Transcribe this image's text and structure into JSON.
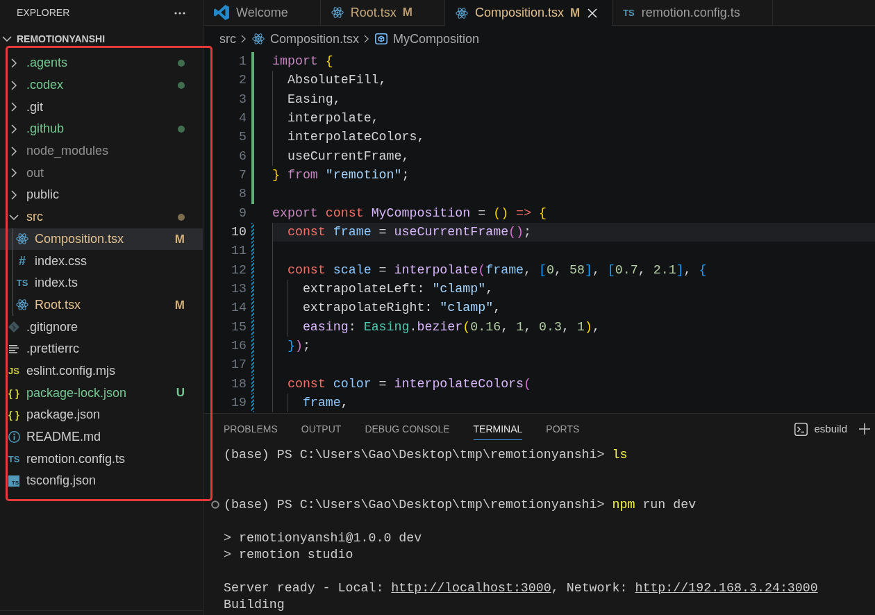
{
  "explorer": {
    "title": "EXPLORER",
    "root": {
      "label": "REMOTIONYANSHI",
      "expanded": true
    },
    "tree": [
      {
        "name": ".agents",
        "kind": "folder",
        "modified": false,
        "untracked": true,
        "ignored": false,
        "expanded": false,
        "selected": false
      },
      {
        "name": ".codex",
        "kind": "folder",
        "modified": false,
        "untracked": true,
        "ignored": false,
        "expanded": false,
        "selected": false
      },
      {
        "name": ".git",
        "kind": "folder",
        "modified": false,
        "untracked": false,
        "ignored": false,
        "expanded": false,
        "selected": false
      },
      {
        "name": ".github",
        "kind": "folder",
        "modified": false,
        "untracked": true,
        "ignored": false,
        "expanded": false,
        "selected": false
      },
      {
        "name": "node_modules",
        "kind": "folder",
        "modified": false,
        "untracked": false,
        "ignored": true,
        "expanded": false,
        "selected": false
      },
      {
        "name": "out",
        "kind": "folder",
        "modified": false,
        "untracked": false,
        "ignored": true,
        "expanded": false,
        "selected": false
      },
      {
        "name": "public",
        "kind": "folder",
        "modified": false,
        "untracked": false,
        "ignored": false,
        "expanded": false,
        "selected": false
      },
      {
        "name": "src",
        "kind": "folder",
        "modified": true,
        "untracked": false,
        "ignored": false,
        "expanded": true,
        "selected": false,
        "children": [
          {
            "name": "Composition.tsx",
            "kind": "react",
            "modified": true,
            "untracked": false,
            "ignored": false,
            "badge": "M",
            "selected": true
          },
          {
            "name": "index.css",
            "kind": "css",
            "icon_text": "#",
            "modified": false,
            "untracked": false,
            "ignored": false,
            "selected": false
          },
          {
            "name": "index.ts",
            "kind": "ts",
            "icon_text": "TS",
            "modified": false,
            "untracked": false,
            "ignored": false,
            "selected": false
          },
          {
            "name": "Root.tsx",
            "kind": "react",
            "modified": true,
            "untracked": false,
            "ignored": false,
            "badge": "M",
            "selected": false
          }
        ]
      },
      {
        "name": ".gitignore",
        "kind": "git",
        "modified": false,
        "untracked": false,
        "ignored": false,
        "selected": false
      },
      {
        "name": ".prettierrc",
        "kind": "lines",
        "modified": false,
        "untracked": false,
        "ignored": false,
        "selected": false
      },
      {
        "name": "eslint.config.mjs",
        "kind": "js",
        "icon_text": "JS",
        "modified": false,
        "untracked": false,
        "ignored": false,
        "selected": false
      },
      {
        "name": "package-lock.json",
        "kind": "json",
        "icon_text": "{ }",
        "modified": false,
        "untracked": true,
        "ignored": false,
        "badge": "U",
        "selected": false
      },
      {
        "name": "package.json",
        "kind": "json",
        "icon_text": "{ }",
        "modified": false,
        "untracked": false,
        "ignored": false,
        "selected": false
      },
      {
        "name": "README.md",
        "kind": "info",
        "modified": false,
        "untracked": false,
        "ignored": false,
        "selected": false
      },
      {
        "name": "remotion.config.ts",
        "kind": "ts",
        "icon_text": "TS",
        "modified": false,
        "untracked": false,
        "ignored": false,
        "selected": false
      },
      {
        "name": "tsconfig.json",
        "kind": "tsconfig",
        "icon_text": "TS",
        "modified": false,
        "untracked": false,
        "ignored": false,
        "selected": false
      }
    ]
  },
  "tabs": [
    {
      "label": "Welcome",
      "kind": "vscode",
      "modified": false,
      "selected": false
    },
    {
      "label": "Root.tsx",
      "kind": "react",
      "modified": true,
      "badge": "M",
      "selected": false
    },
    {
      "label": "Composition.tsx",
      "kind": "react",
      "modified": true,
      "badge": "M",
      "selected": true
    },
    {
      "label": "remotion.config.ts",
      "kind": "ts",
      "icon_text": "TS",
      "modified": false,
      "selected": false
    }
  ],
  "breadcrumbs": [
    {
      "label": "src",
      "kind": "folder"
    },
    {
      "label": "Composition.tsx",
      "kind": "react"
    },
    {
      "label": "MyComposition",
      "kind": "symbol"
    }
  ],
  "editor": {
    "lines": [
      {
        "number": "1",
        "added": true,
        "modified": false,
        "current": false,
        "tokens": [
          {
            "text": "import ",
            "kind": "keyword"
          },
          {
            "text": "{",
            "kind": "bracket1"
          }
        ]
      },
      {
        "number": "2",
        "added": true,
        "modified": false,
        "current": false,
        "tokens": [
          {
            "text": "  AbsoluteFill,",
            "kind": "plain"
          }
        ]
      },
      {
        "number": "3",
        "added": true,
        "modified": false,
        "current": false,
        "tokens": [
          {
            "text": "  Easing,",
            "kind": "plain"
          }
        ]
      },
      {
        "number": "4",
        "added": true,
        "modified": false,
        "current": false,
        "tokens": [
          {
            "text": "  interpolate,",
            "kind": "plain"
          }
        ]
      },
      {
        "number": "5",
        "added": true,
        "modified": false,
        "current": false,
        "tokens": [
          {
            "text": "  interpolateColors,",
            "kind": "plain"
          }
        ]
      },
      {
        "number": "6",
        "added": true,
        "modified": false,
        "current": false,
        "tokens": [
          {
            "text": "  useCurrentFrame,",
            "kind": "plain"
          }
        ]
      },
      {
        "number": "7",
        "added": true,
        "modified": false,
        "current": false,
        "tokens": [
          {
            "text": "}",
            "kind": "bracket1"
          },
          {
            "text": " from ",
            "kind": "keyword"
          },
          {
            "text": "\"remotion\"",
            "kind": "string"
          },
          {
            "text": ";",
            "kind": "plain"
          }
        ]
      },
      {
        "number": "8",
        "added": true,
        "modified": false,
        "current": false
      },
      {
        "number": "9",
        "added": false,
        "modified": false,
        "current": false,
        "tokens": [
          {
            "text": "export ",
            "kind": "keyword"
          },
          {
            "text": "const ",
            "kind": "storage"
          },
          {
            "text": "MyComposition",
            "kind": "function"
          },
          {
            "text": " = ",
            "kind": "plain"
          },
          {
            "text": "()",
            "kind": "bracket1"
          },
          {
            "text": " => ",
            "kind": "storage"
          },
          {
            "text": "{",
            "kind": "bracket1"
          }
        ]
      },
      {
        "number": "10",
        "added": false,
        "modified": true,
        "current": true,
        "tokens": [
          {
            "text": "  const ",
            "kind": "storage"
          },
          {
            "text": "frame",
            "kind": "variable"
          },
          {
            "text": " = ",
            "kind": "plain"
          },
          {
            "text": "useCurrentFrame",
            "kind": "function"
          },
          {
            "text": "()",
            "kind": "bracket2"
          },
          {
            "text": ";",
            "kind": "plain"
          }
        ]
      },
      {
        "number": "11",
        "added": false,
        "modified": true,
        "current": false
      },
      {
        "number": "12",
        "added": false,
        "modified": true,
        "current": false,
        "tokens": [
          {
            "text": "  const ",
            "kind": "storage"
          },
          {
            "text": "scale",
            "kind": "variable"
          },
          {
            "text": " = ",
            "kind": "plain"
          },
          {
            "text": "interpolate",
            "kind": "function"
          },
          {
            "text": "(",
            "kind": "bracket2"
          },
          {
            "text": "frame",
            "kind": "variable"
          },
          {
            "text": ", ",
            "kind": "plain"
          },
          {
            "text": "[",
            "kind": "bracket3"
          },
          {
            "text": "0",
            "kind": "number"
          },
          {
            "text": ", ",
            "kind": "plain"
          },
          {
            "text": "58",
            "kind": "number"
          },
          {
            "text": "]",
            "kind": "bracket3"
          },
          {
            "text": ", ",
            "kind": "plain"
          },
          {
            "text": "[",
            "kind": "bracket3"
          },
          {
            "text": "0.7",
            "kind": "number"
          },
          {
            "text": ", ",
            "kind": "plain"
          },
          {
            "text": "2.1",
            "kind": "number"
          },
          {
            "text": "]",
            "kind": "bracket3"
          },
          {
            "text": ", ",
            "kind": "plain"
          },
          {
            "text": "{",
            "kind": "bracket3"
          }
        ]
      },
      {
        "number": "13",
        "added": false,
        "modified": true,
        "current": false,
        "tokens": [
          {
            "text": "    extrapolateLeft: ",
            "kind": "plain"
          },
          {
            "text": "\"clamp\"",
            "kind": "string"
          },
          {
            "text": ",",
            "kind": "plain"
          }
        ]
      },
      {
        "number": "14",
        "added": false,
        "modified": true,
        "current": false,
        "tokens": [
          {
            "text": "    extrapolateRight: ",
            "kind": "plain"
          },
          {
            "text": "\"clamp\"",
            "kind": "string"
          },
          {
            "text": ",",
            "kind": "plain"
          }
        ]
      },
      {
        "number": "15",
        "added": false,
        "modified": true,
        "current": false,
        "tokens": [
          {
            "text": "    easing",
            "kind": "function"
          },
          {
            "text": ": ",
            "kind": "plain"
          },
          {
            "text": "Easing",
            "kind": "type"
          },
          {
            "text": ".",
            "kind": "plain"
          },
          {
            "text": "bezier",
            "kind": "function"
          },
          {
            "text": "(",
            "kind": "bracket1"
          },
          {
            "text": "0.16",
            "kind": "number"
          },
          {
            "text": ", ",
            "kind": "plain"
          },
          {
            "text": "1",
            "kind": "number"
          },
          {
            "text": ", ",
            "kind": "plain"
          },
          {
            "text": "0.3",
            "kind": "number"
          },
          {
            "text": ", ",
            "kind": "plain"
          },
          {
            "text": "1",
            "kind": "number"
          },
          {
            "text": ")",
            "kind": "bracket1"
          },
          {
            "text": ",",
            "kind": "plain"
          }
        ]
      },
      {
        "number": "16",
        "added": false,
        "modified": true,
        "current": false,
        "tokens": [
          {
            "text": "  }",
            "kind": "bracket3"
          },
          {
            "text": ")",
            "kind": "bracket2"
          },
          {
            "text": ";",
            "kind": "plain"
          }
        ]
      },
      {
        "number": "17",
        "added": false,
        "modified": true,
        "current": false
      },
      {
        "number": "18",
        "added": false,
        "modified": true,
        "current": false,
        "tokens": [
          {
            "text": "  const ",
            "kind": "storage"
          },
          {
            "text": "color",
            "kind": "variable"
          },
          {
            "text": " = ",
            "kind": "plain"
          },
          {
            "text": "interpolateColors",
            "kind": "function"
          },
          {
            "text": "(",
            "kind": "bracket2"
          }
        ]
      },
      {
        "number": "19",
        "added": false,
        "modified": true,
        "current": false,
        "tokens": [
          {
            "text": "    frame",
            "kind": "variable"
          },
          {
            "text": ",",
            "kind": "plain"
          }
        ]
      }
    ]
  },
  "panel": {
    "tabs": [
      {
        "label": "PROBLEMS",
        "selected": false
      },
      {
        "label": "OUTPUT",
        "selected": false
      },
      {
        "label": "DEBUG CONSOLE",
        "selected": false
      },
      {
        "label": "TERMINAL",
        "selected": true
      },
      {
        "label": "PORTS",
        "selected": false
      }
    ],
    "terminal": {
      "name": "esbuild",
      "lines": [
        {
          "kind": "prompt",
          "marked": false,
          "prompt": "(base) PS C:\\Users\\Gao\\Desktop\\tmp\\remotionyanshi>",
          "command": "ls"
        },
        {
          "kind": "blank"
        },
        {
          "kind": "blank"
        },
        {
          "kind": "prompt",
          "marked": true,
          "prompt": "(base) PS C:\\Users\\Gao\\Desktop\\tmp\\remotionyanshi>",
          "command": "npm",
          "args": "run dev"
        },
        {
          "kind": "blank"
        },
        {
          "kind": "output",
          "segments": [
            {
              "text": "> remotionyanshi@1.0.0 dev",
              "link": false
            }
          ]
        },
        {
          "kind": "output",
          "segments": [
            {
              "text": "> remotion studio",
              "link": false
            }
          ]
        },
        {
          "kind": "blank"
        },
        {
          "kind": "output",
          "segments": [
            {
              "text": "Server ready - Local: ",
              "link": false
            },
            {
              "text": "http://localhost:3000",
              "link": true
            },
            {
              "text": ", Network: ",
              "link": false
            },
            {
              "text": "http://192.168.3.24:3000",
              "link": true
            }
          ]
        },
        {
          "kind": "output",
          "segments": [
            {
              "text": "Building",
              "link": false
            }
          ]
        }
      ]
    }
  }
}
